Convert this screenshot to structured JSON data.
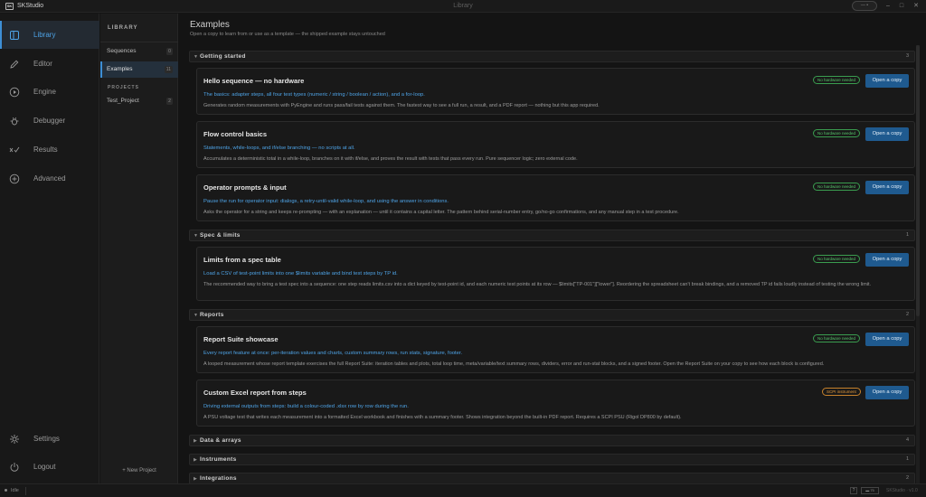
{
  "window": {
    "logo_text": "SK",
    "app_name": "SKStudio",
    "title": "Library",
    "pill_label": "— •",
    "controls": {
      "minimize": "–",
      "maximize": "□",
      "close": "✕"
    }
  },
  "nav": {
    "items": [
      {
        "label": "Library",
        "icon": "library-icon"
      },
      {
        "label": "Editor",
        "icon": "pencil-icon"
      },
      {
        "label": "Engine",
        "icon": "play-circle-icon"
      },
      {
        "label": "Debugger",
        "icon": "bug-icon"
      },
      {
        "label": "Results",
        "icon": "results-icon"
      },
      {
        "label": "Advanced",
        "icon": "plus-circle-icon"
      }
    ],
    "bottom": [
      {
        "label": "Settings",
        "icon": "gear-icon"
      },
      {
        "label": "Logout",
        "icon": "power-icon"
      }
    ],
    "accent": "#3d8fd6"
  },
  "library_panel": {
    "heading": "LIBRARY",
    "items": [
      {
        "label": "Sequences",
        "count": "0"
      },
      {
        "label": "Examples",
        "count": "11"
      }
    ],
    "projects_heading": "PROJECTS",
    "projects": [
      {
        "label": "Test_Project",
        "count": "2"
      }
    ],
    "new_project": "+ New Project"
  },
  "main": {
    "title": "Examples",
    "subtitle": "Open a copy to learn from or use as a template — the shipped example stays untouched",
    "groups": [
      {
        "name": "Getting started",
        "count": "3"
      },
      {
        "name": "Spec & limits",
        "count": "1"
      },
      {
        "name": "Reports",
        "count": "2"
      },
      {
        "name": "Data & arrays",
        "count": "4"
      },
      {
        "name": "Instruments",
        "count": "1"
      },
      {
        "name": "Integrations",
        "count": "2"
      }
    ],
    "cards": [
      {
        "title": "Hello sequence — no hardware",
        "tagline": "The basics: adapter steps, all four test types (numeric / string / boolean / action), and a for-loop.",
        "description": "Generates random measurements with PyEngine and runs pass/fail tests against them. The fastest way to see a full run, a result, and a PDF report — nothing but this app required.",
        "badge": "No hardware needed",
        "button": "Open a copy"
      },
      {
        "title": "Flow control basics",
        "tagline": "Statements, while-loops, and if/else branching — no scripts at all.",
        "description": "Accumulates a deterministic total in a while-loop, branches on it with if/else, and proves the result with tests that pass every run. Pure sequencer logic; zero external code.",
        "badge": "No hardware needed",
        "button": "Open a copy"
      },
      {
        "title": "Operator prompts & input",
        "tagline": "Pause the run for operator input: dialogs, a retry-until-valid while-loop, and using the answer in conditions.",
        "description": "Asks the operator for a string and keeps re-prompting — with an explanation — until it contains a capital letter. The pattern behind serial-number entry, go/no-go confirmations, and any manual step in a test procedure.",
        "badge": "No hardware needed",
        "button": "Open a copy"
      },
      {
        "title": "Limits from a spec table",
        "tagline": "Load a CSV of test-point limits into one $limits variable and bind test steps by TP id.",
        "description": "The recommended way to bring a test spec into a sequence: one step reads limits.csv into a dict keyed by test-point id, and each numeric test points at its row — $limits[\"TP-001\"][\"lower\"]. Reordering the spreadsheet can't break bindings, and a removed TP id fails loudly instead of testing the wrong limit.",
        "badge": "No hardware needed",
        "button": "Open a copy"
      },
      {
        "title": "Report Suite showcase",
        "tagline": "Every report feature at once: per-iteration values and charts, custom summary rows, run stats, signature, footer.",
        "description": "A looped measurement whose report template exercises the full Report Suite: iteration tables and plots, total loop time, meta/variable/text summary rows, dividers, error and run-stat blocks, and a signed footer. Open the Report Suite on your copy to see how each block is configured.",
        "badge": "No hardware needed",
        "button": "Open a copy"
      },
      {
        "title": "Custom Excel report from steps",
        "tagline": "Driving external outputs from steps: build a colour-coded .xlsx row by row during the run.",
        "description": "A PSU voltage test that writes each measurement into a formatted Excel workbook and finishes with a summary footer. Shows integration beyond the built-in PDF report. Requires a SCPI PSU (Rigol DP800 by default).",
        "badge": "SCPI instrument",
        "button": "Open a copy"
      }
    ],
    "colors": {
      "tag": "#4ea3e6",
      "badge_green": "#55c46a",
      "badge_orange": "#e4983a",
      "button": "#1f5a8f"
    }
  },
  "status": {
    "state": "Idle",
    "help": "?",
    "monitor": "▬ 75",
    "version": "SKStudio · v1.0"
  }
}
